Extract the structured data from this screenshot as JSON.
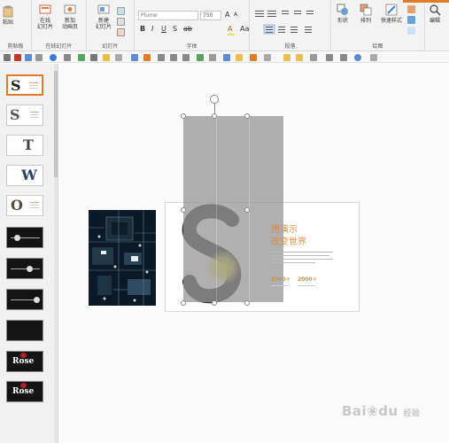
{
  "ribbon": {
    "clipboard_label": "剪贴板",
    "clipboard_paste": "粘贴",
    "online_slides": "在线幻灯片",
    "online_btn_line1": "在线",
    "online_btn_line2": "幻灯片",
    "new_animation_line1": "新加",
    "new_animation_line2": "动画页",
    "slides_group_label": "幻灯片",
    "new_slide_line1": "新建",
    "new_slide_line2": "幻灯片",
    "font_group_label": "字体",
    "font_name": "Plume",
    "font_size": "750",
    "paragraph_group_label": "段落",
    "drawing_group_label": "绘图",
    "shape_label": "形状",
    "arrange_label": "排列",
    "quick_style_label": "快速样式",
    "edit_label": "编辑"
  },
  "slides_panel": {
    "thumbs": [
      {
        "letter": "S",
        "kind": "light",
        "selected": true
      },
      {
        "letter": "S",
        "kind": "light",
        "selected": false
      },
      {
        "letter": "T",
        "kind": "light",
        "selected": false
      },
      {
        "letter": "W",
        "kind": "light",
        "selected": false
      },
      {
        "letter": "O",
        "kind": "light",
        "selected": false
      },
      {
        "letter": "",
        "kind": "dark",
        "selected": false
      },
      {
        "letter": "",
        "kind": "dark",
        "selected": false
      },
      {
        "letter": "",
        "kind": "dark",
        "selected": false
      },
      {
        "letter": "",
        "kind": "dark",
        "selected": false
      },
      {
        "letter": "Rose",
        "kind": "dark-rose",
        "selected": false
      },
      {
        "letter": "Rose",
        "kind": "dark-rose",
        "selected": false
      }
    ]
  },
  "slide": {
    "title_line1": "用演示",
    "title_line2": "改变世界",
    "stat1": "2300+",
    "stat2": "2000+"
  },
  "colors": {
    "accent_orange": "#e07b2c",
    "brush_yellow": "#e8e04a",
    "brush_black": "#1a1a1a"
  },
  "watermark": {
    "brand": "Bai",
    "paw": "du",
    "suffix": "经验"
  }
}
